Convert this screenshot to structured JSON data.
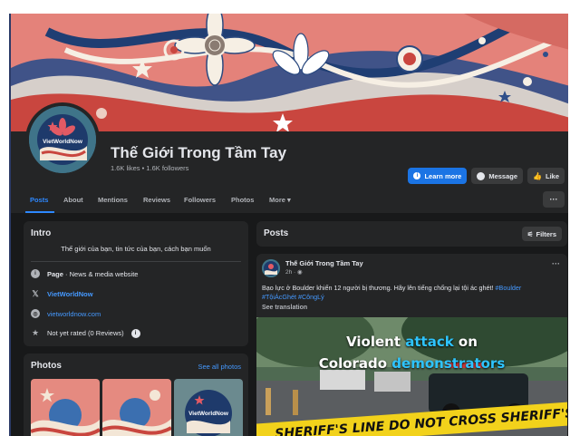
{
  "page": {
    "name": "Thế Giới Trong Tầm Tay",
    "stats": "1.6K likes • 1.6K followers",
    "avatar_brand": "VietWorldNow"
  },
  "actions": {
    "learn_more": "Learn more",
    "message": "Message",
    "like": "Like"
  },
  "tabs": [
    {
      "label": "Posts",
      "active": true
    },
    {
      "label": "About"
    },
    {
      "label": "Mentions"
    },
    {
      "label": "Reviews"
    },
    {
      "label": "Followers"
    },
    {
      "label": "Photos"
    },
    {
      "label": "More ▾"
    }
  ],
  "more_dots": "···",
  "intro": {
    "title": "Intro",
    "description": "Thế giới của bạn, tin tức của bạn, cách bạn muốn",
    "page_type_label": "Page",
    "page_type_value": " · News & media website",
    "x_handle": "VietWorldNow",
    "website": "vietworldnow.com",
    "rating": "Not yet rated (0 Reviews)"
  },
  "photos": {
    "title": "Photos",
    "see_all": "See all photos",
    "thumb_brand": "VietWorldNow"
  },
  "posts_header": {
    "title": "Posts",
    "filters": "Filters"
  },
  "post": {
    "author": "Thế Giới Trong Tầm Tay",
    "time": "2h · ",
    "more": "···",
    "text": "Bạo lực ở Boulder khiến 12 người bị thương. Hãy lên tiếng chống lại tội ác ghét!",
    "hashtag1": " #Boulder",
    "hashtag2": "#TộiÁcGhét",
    "hashtag3": " #CôngLý",
    "see_translation": "See translation",
    "image_line1_a": "Violent ",
    "image_line1_b": "attack",
    "image_line1_c": " on",
    "image_line2_a": "Colorado ",
    "image_line2_b": "demonstrators",
    "tape_text": "SHERIFF'S LINE DO NOT CROSS     SHERIFF'S"
  },
  "colors": {
    "background": "#18191a",
    "card": "#242526",
    "accent": "#2d88ff",
    "cover": "#e0746c"
  }
}
